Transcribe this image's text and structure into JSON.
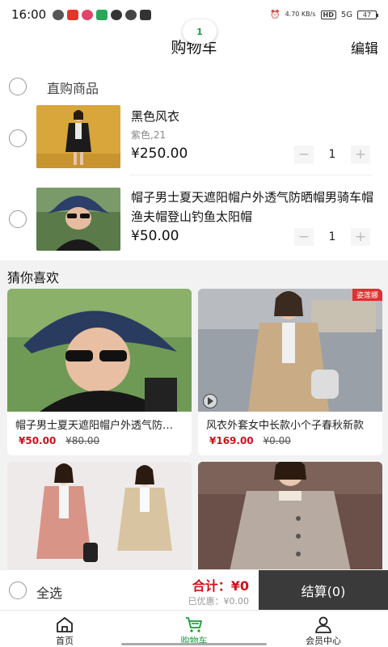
{
  "status_bar": {
    "time": "16:00",
    "net_speed": "4.70 KB/s",
    "network": "5G",
    "battery": "47"
  },
  "header": {
    "title": "购物车",
    "edit_label": "编辑",
    "badge_text": "1"
  },
  "cart": {
    "group_label": "直购商品",
    "items": [
      {
        "name": "黑色风衣",
        "spec": "紫色,21",
        "price": "¥250.00",
        "quantity": "1"
      },
      {
        "name": "帽子男士夏天遮阳帽户外透气防晒帽男骑车帽渔夫帽登山钓鱼太阳帽",
        "spec": "",
        "price": "¥50.00",
        "quantity": "1"
      }
    ],
    "minus": "−",
    "plus": "+"
  },
  "guess": {
    "title": "猜你喜欢",
    "products": [
      {
        "title": "帽子男士夏天遮阳帽户外透气防晒帽男骑车帽",
        "price": "¥50.00",
        "old_price": "¥80.00",
        "tag": ""
      },
      {
        "title": "风衣外套女中长款小个子春秋新款",
        "price": "¥169.00",
        "old_price": "¥0.00",
        "tag": "姿莲娜"
      },
      {
        "title": "",
        "price": "",
        "old_price": "",
        "tag": ""
      },
      {
        "title": "",
        "price": "",
        "old_price": "",
        "tag": ""
      }
    ]
  },
  "checkout": {
    "select_all": "全选",
    "total": "合计：¥0",
    "discount": "已优惠：¥0.00",
    "pay_button": "结算(0)"
  },
  "tabbar": [
    {
      "label": "首页",
      "icon": "home-icon"
    },
    {
      "label": "购物车",
      "icon": "cart-icon",
      "active": true
    },
    {
      "label": "会员中心",
      "icon": "user-icon"
    }
  ],
  "colors": {
    "accent_green": "#1a9a3a",
    "price_red": "#d0101a",
    "pay_button_bg": "#3a3a3a"
  }
}
